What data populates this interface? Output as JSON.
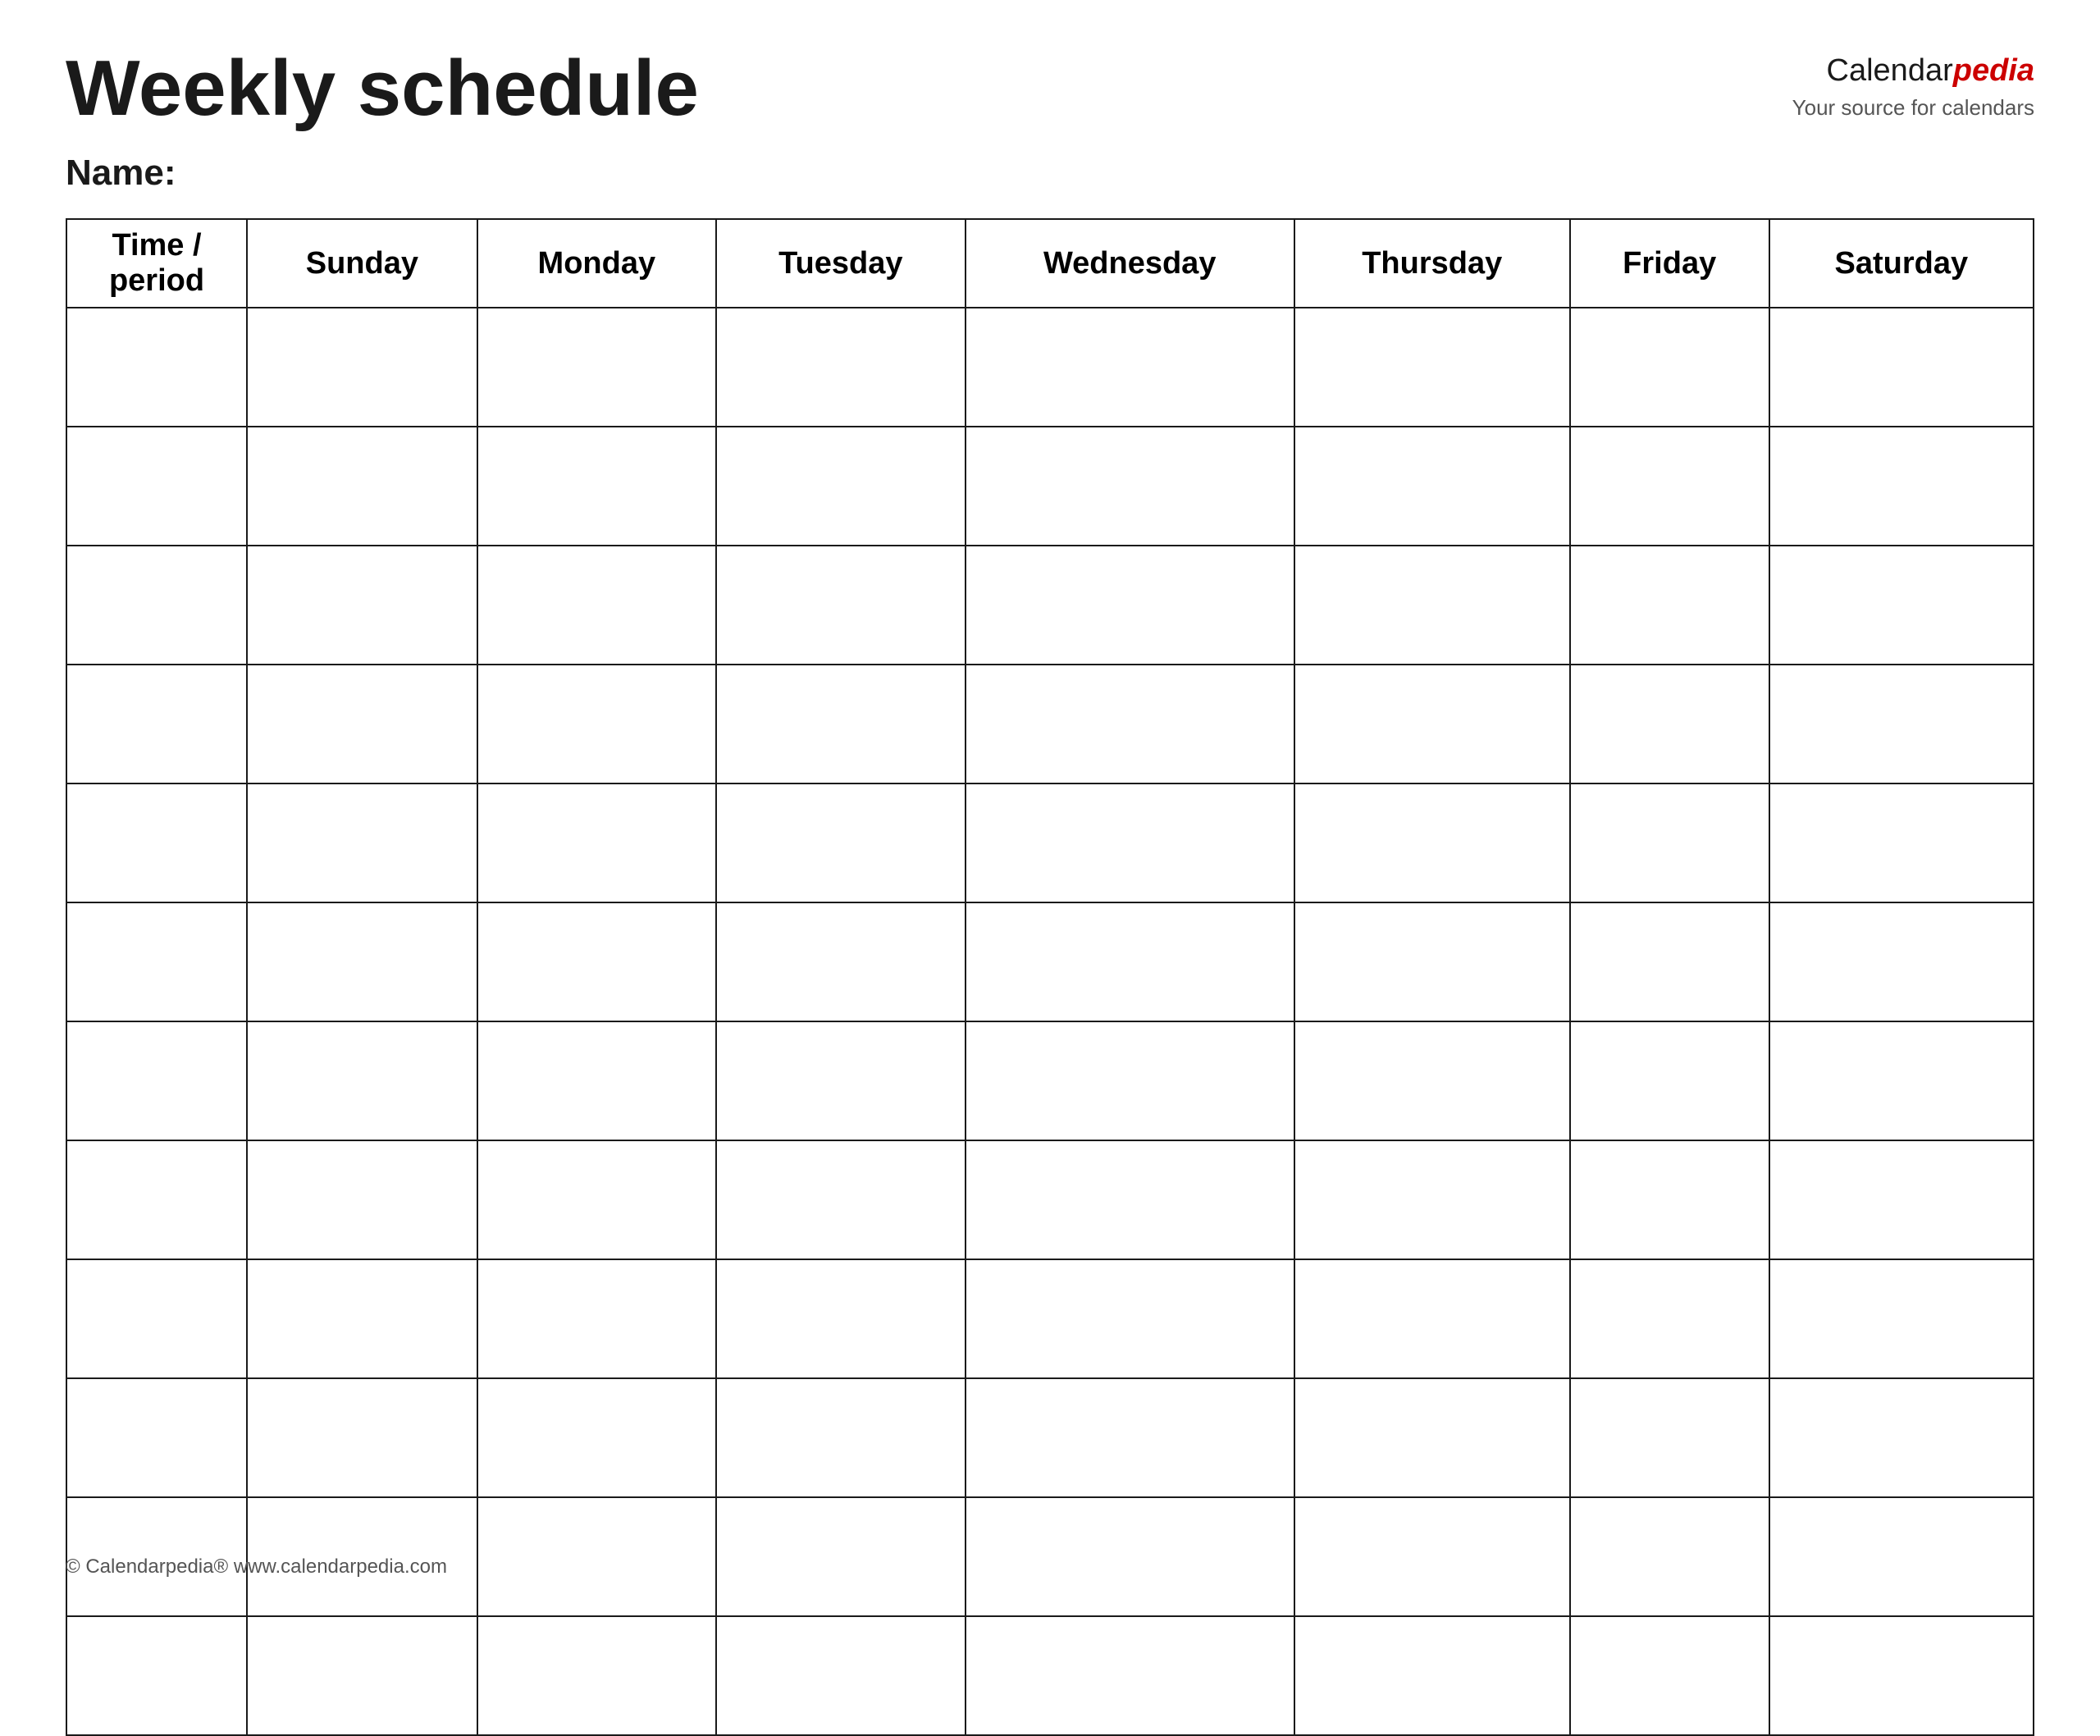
{
  "header": {
    "title": "Weekly schedule",
    "brand_calendar": "Calendar",
    "brand_pedia": "pedia",
    "brand_sub": "Your source for calendars"
  },
  "name_label": "Name:",
  "columns": [
    "Time / period",
    "Sunday",
    "Monday",
    "Tuesday",
    "Wednesday",
    "Thursday",
    "Friday",
    "Saturday"
  ],
  "num_rows": 12,
  "footer": "© Calendarpedia®  www.calendarpedia.com"
}
